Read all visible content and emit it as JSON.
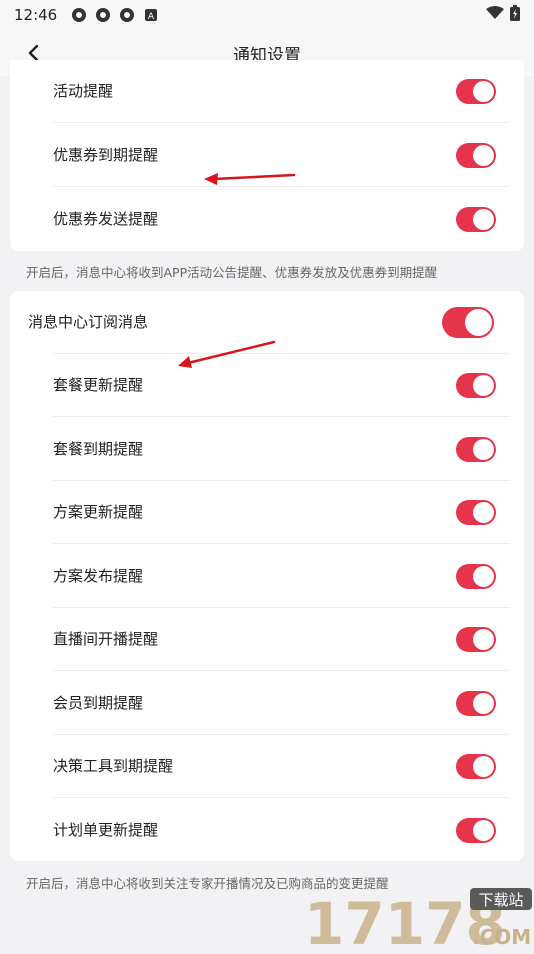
{
  "status": {
    "time": "12:46",
    "icons": [
      "app-icon",
      "app-icon",
      "app-icon",
      "a-icon"
    ],
    "right_icons": [
      "wifi-icon",
      "battery-icon"
    ]
  },
  "header": {
    "title": "通知设置"
  },
  "card1": {
    "items": [
      {
        "label": "活动提醒",
        "on": true
      },
      {
        "label": "优惠券到期提醒",
        "on": true
      },
      {
        "label": "优惠券发送提醒",
        "on": true
      }
    ],
    "note": "开启后，消息中心将收到APP活动公告提醒、优惠券发放及优惠券到期提醒"
  },
  "card2": {
    "main": {
      "label": "消息中心订阅消息",
      "on": true
    },
    "items": [
      {
        "label": "套餐更新提醒",
        "on": true
      },
      {
        "label": "套餐到期提醒",
        "on": true
      },
      {
        "label": "方案更新提醒",
        "on": true
      },
      {
        "label": "方案发布提醒",
        "on": true
      },
      {
        "label": "直播间开播提醒",
        "on": true
      },
      {
        "label": "会员到期提醒",
        "on": true
      },
      {
        "label": "决策工具到期提醒",
        "on": true
      },
      {
        "label": "计划单更新提醒",
        "on": true
      }
    ],
    "note": "开启后，消息中心将收到关注专家开播情况及已购商品的变更提醒"
  },
  "watermark": {
    "digits": "17178",
    "tag": "下载站",
    "com": ".COM"
  },
  "colors": {
    "accent": "#e5344b",
    "arrow": "#d8151c",
    "watermark": "#c8b28a"
  }
}
